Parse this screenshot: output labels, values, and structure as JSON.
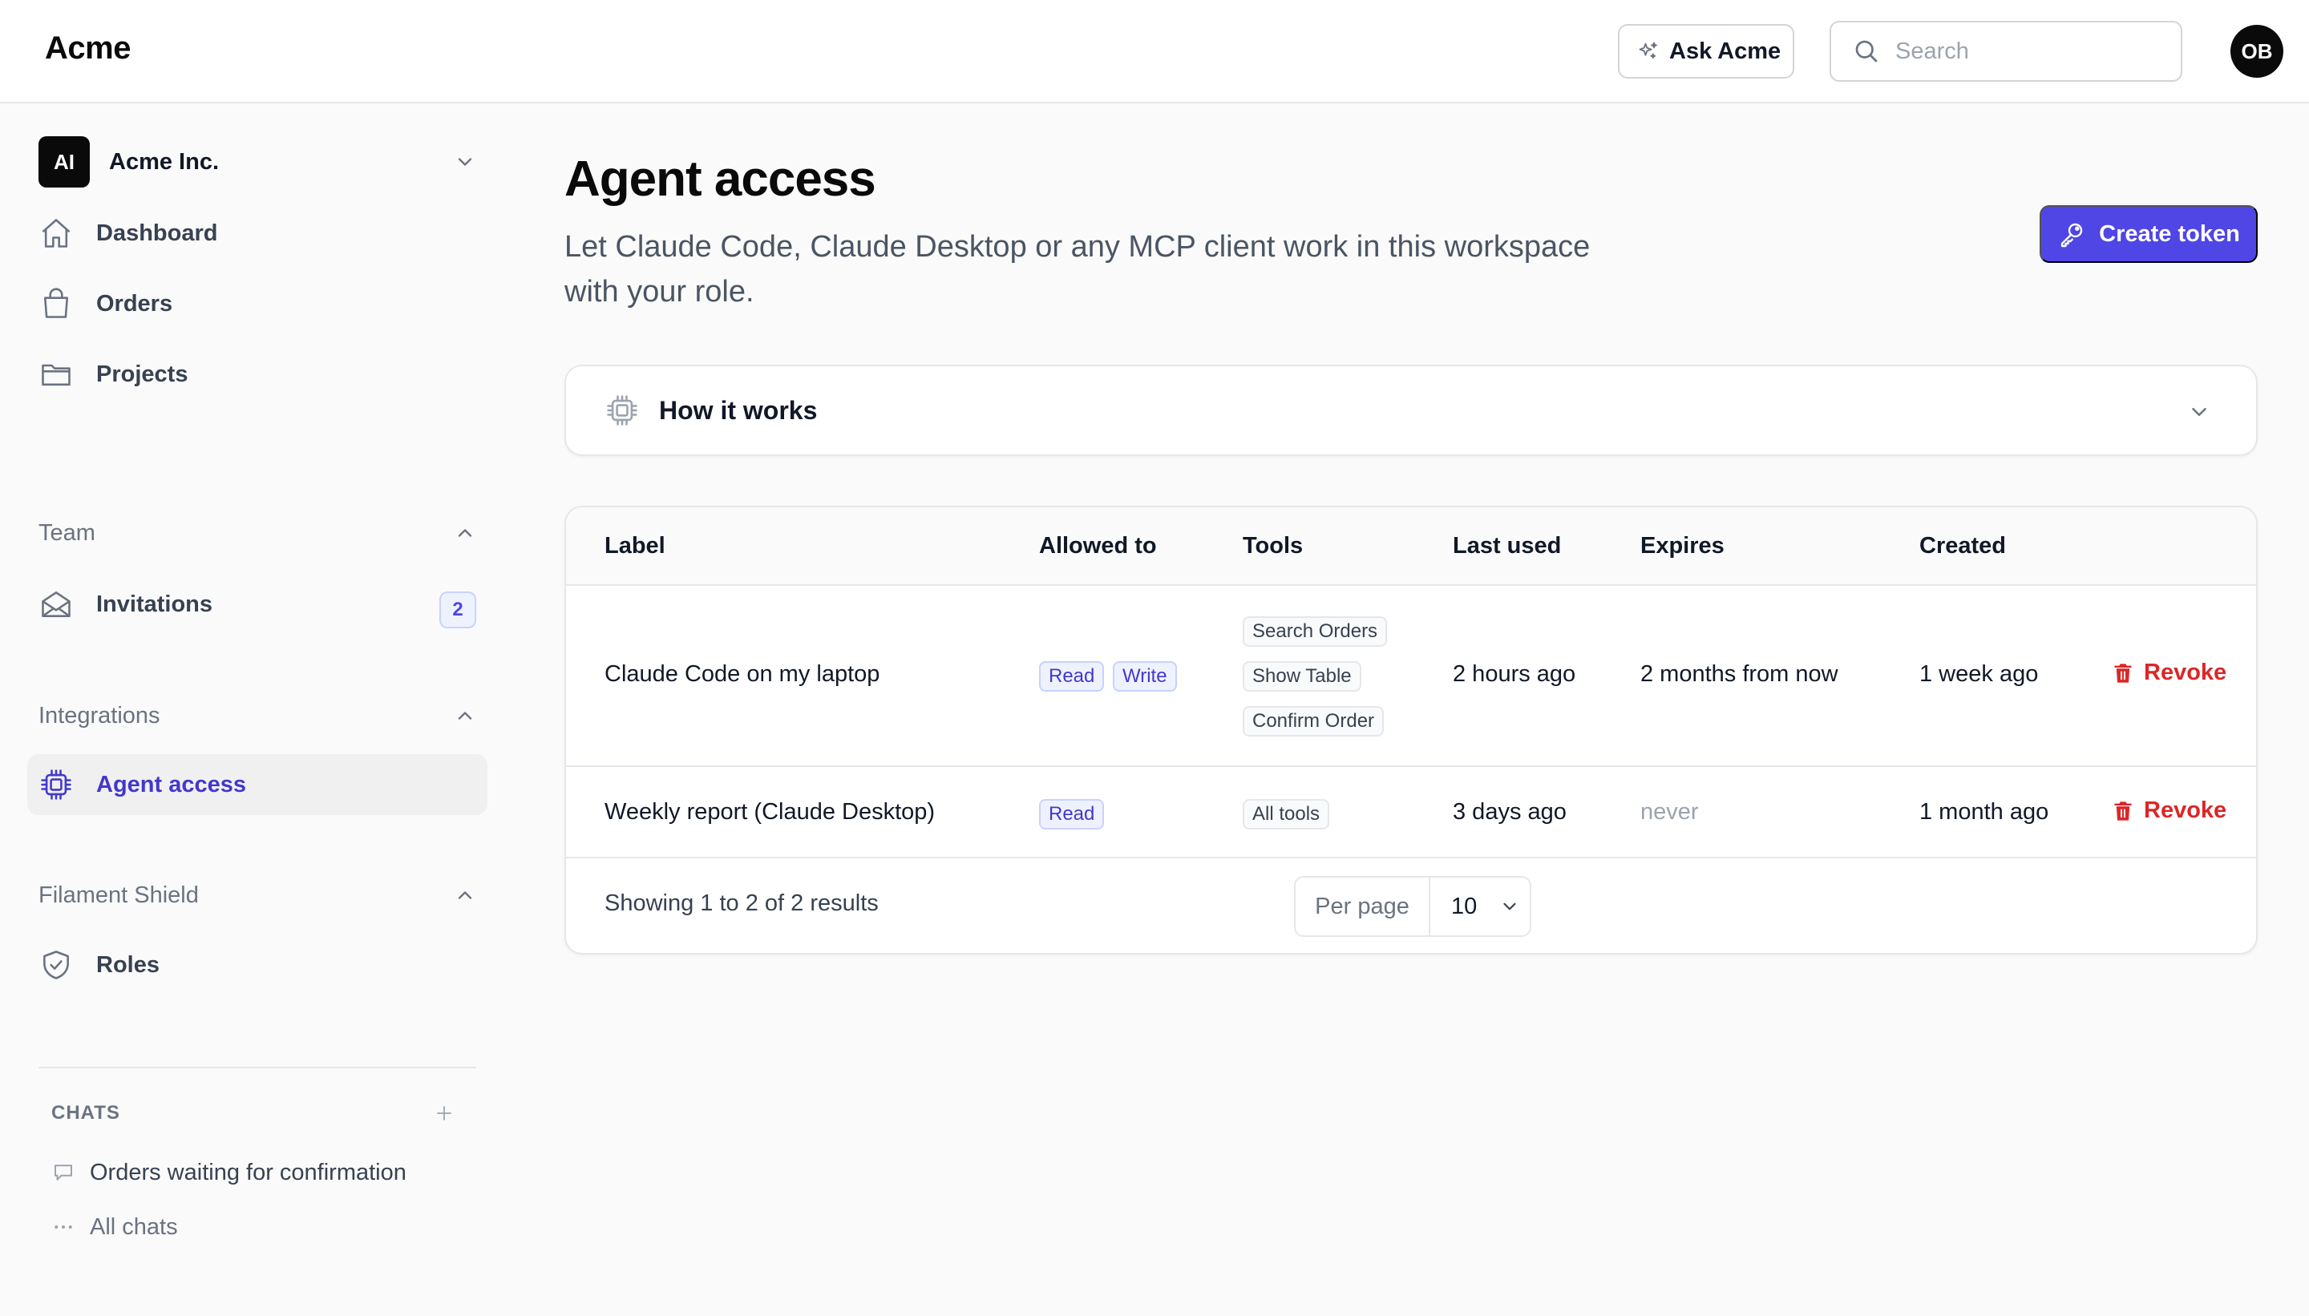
{
  "brand": "Acme",
  "topbar": {
    "ask_label": "Ask Acme",
    "search_placeholder": "Search",
    "avatar_initials": "OB"
  },
  "sidebar": {
    "workspace": {
      "initials": "AI",
      "name": "Acme Inc."
    },
    "nav": [
      {
        "label": "Dashboard",
        "icon": "home-icon"
      },
      {
        "label": "Orders",
        "icon": "shopping-bag-icon"
      },
      {
        "label": "Projects",
        "icon": "folder-icon"
      }
    ],
    "groups": {
      "team": {
        "label": "Team",
        "items": [
          {
            "label": "Invitations",
            "icon": "envelope-open-icon",
            "badge": "2"
          }
        ]
      },
      "integrations": {
        "label": "Integrations",
        "items": [
          {
            "label": "Agent access",
            "icon": "cpu-chip-icon",
            "active": true
          }
        ]
      },
      "shield": {
        "label": "Filament Shield",
        "items": [
          {
            "label": "Roles",
            "icon": "shield-check-icon"
          }
        ]
      }
    },
    "chats": {
      "heading": "CHATS",
      "items": [
        {
          "label": "Orders waiting for confirmation",
          "icon": "chat-bubble-icon"
        }
      ],
      "all_label": "All chats"
    }
  },
  "main": {
    "title": "Agent access",
    "description": "Let Claude Code, Claude Desktop or any MCP client work in this workspace with your role.",
    "create_label": "Create token",
    "how_label": "How it works",
    "table": {
      "columns": [
        "Label",
        "Allowed to",
        "Tools",
        "Last used",
        "Expires",
        "Created"
      ],
      "rows": [
        {
          "label": "Claude Code on my laptop",
          "allowed": [
            "Read",
            "Write"
          ],
          "tools": [
            "Search Orders",
            "Show Table",
            "Confirm Order"
          ],
          "last_used": "2 hours ago",
          "expires": "2 months from now",
          "created": "1 week ago",
          "action": "Revoke"
        },
        {
          "label": "Weekly report (Claude Desktop)",
          "allowed": [
            "Read"
          ],
          "tools": [
            "All tools"
          ],
          "last_used": "3 days ago",
          "expires": "never",
          "created": "1 month ago",
          "action": "Revoke"
        }
      ],
      "footer": {
        "summary": "Showing 1 to 2 of 2 results",
        "per_page_label": "Per page",
        "per_page_value": "10"
      }
    }
  },
  "colors": {
    "accent": "#4f46e5",
    "active_text": "#4338ca",
    "danger": "#dc2626",
    "badge_bg": "#eef2ff"
  }
}
